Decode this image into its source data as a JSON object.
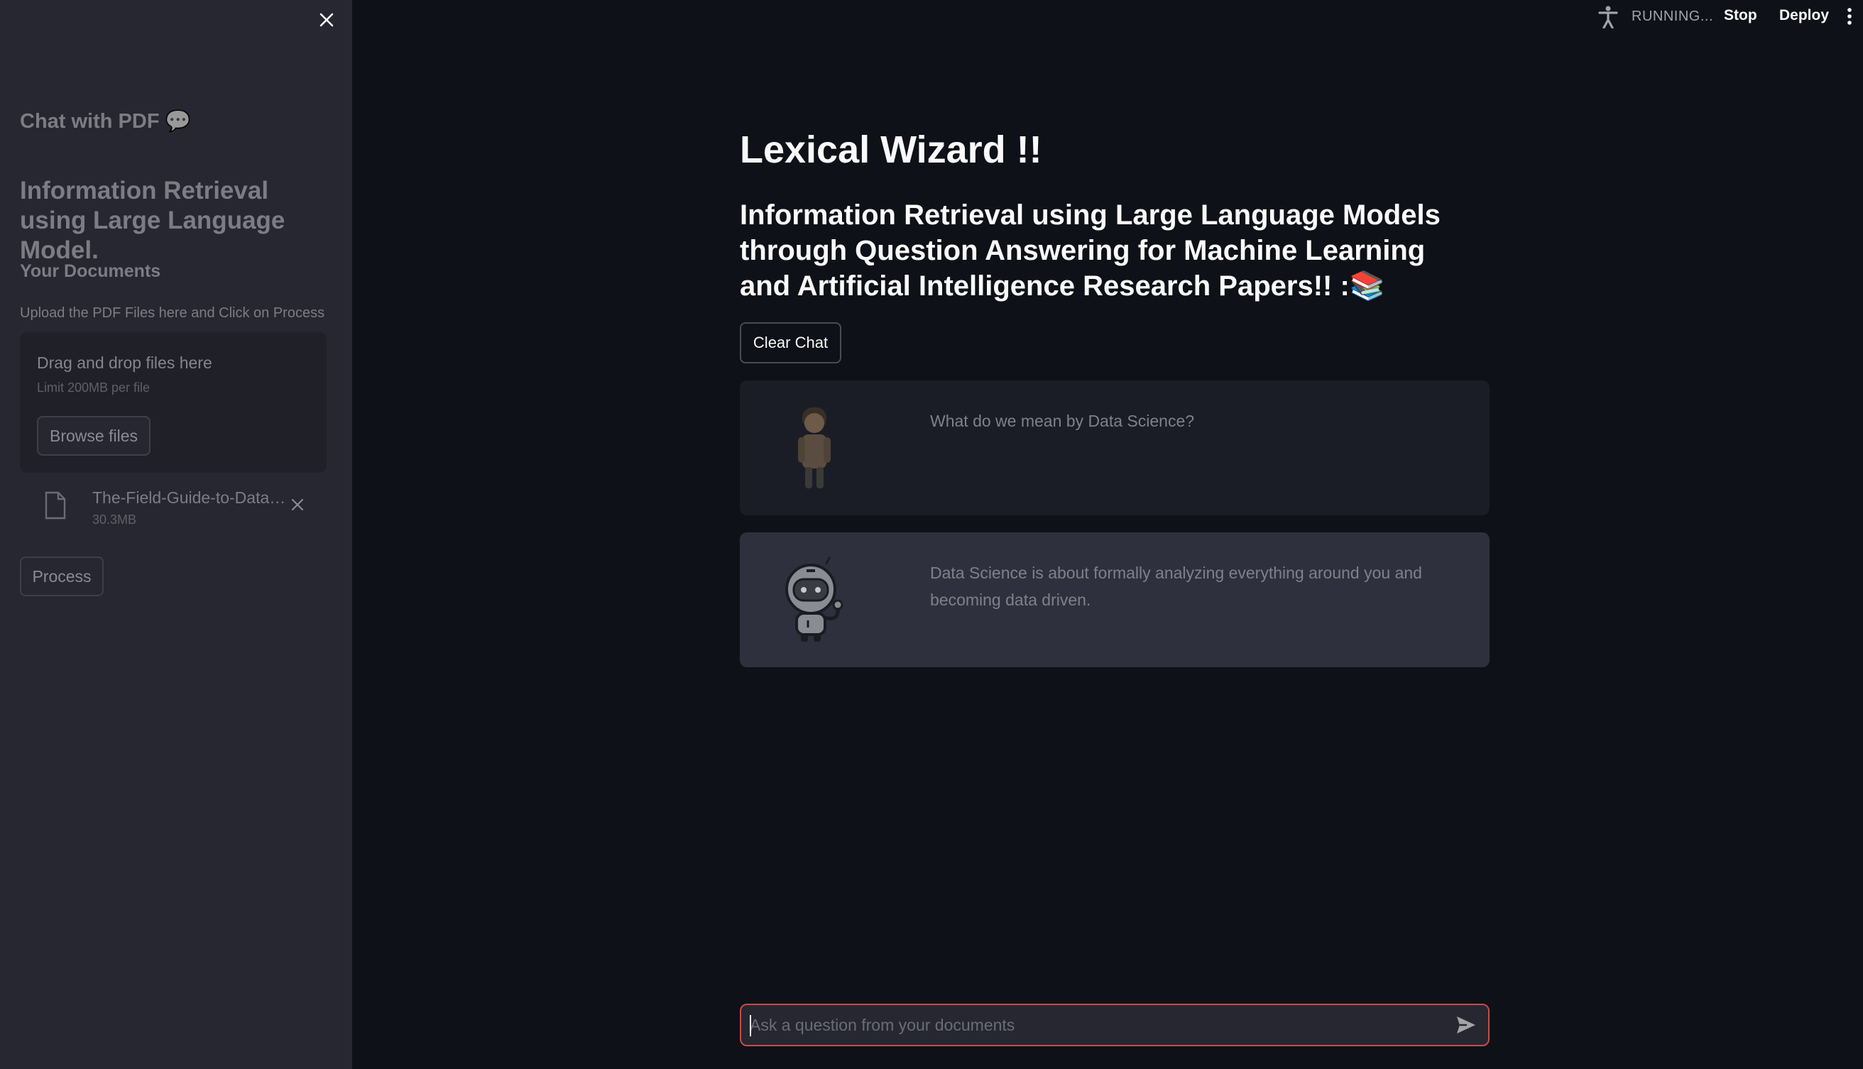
{
  "header": {
    "status_text": "RUNNING...",
    "stop_label": "Stop",
    "deploy_label": "Deploy"
  },
  "sidebar": {
    "title": "Chat with PDF",
    "title_emoji": "💬",
    "subtitle": "Information Retrieval using Large Language Model.",
    "documents_heading": "Your Documents",
    "upload_label": "Upload the PDF Files here and Click on Process",
    "dropzone": {
      "title": "Drag and drop files here",
      "limit": "Limit 200MB per file",
      "browse_label": "Browse files"
    },
    "file": {
      "name": "The-Field-Guide-to-Data-Science.pdf",
      "size": "30.3MB"
    },
    "process_label": "Process"
  },
  "main": {
    "title": "Lexical Wizard !!",
    "subtitle": "Information Retrieval using Large Language Models through Question Answering for Machine Learning and Artificial Intelligence Research Papers!! :📚",
    "clear_chat_label": "Clear Chat",
    "messages": [
      {
        "role": "user",
        "text": "What do we mean by Data Science?"
      },
      {
        "role": "assistant",
        "text": "Data Science is about formally analyzing everything around you and becoming data driven."
      }
    ]
  },
  "chat_input": {
    "placeholder": "Ask a question from your documents",
    "value": ""
  },
  "colors": {
    "background": "#0e1117",
    "sidebar": "#262730",
    "input_border": "#c94b4b"
  }
}
